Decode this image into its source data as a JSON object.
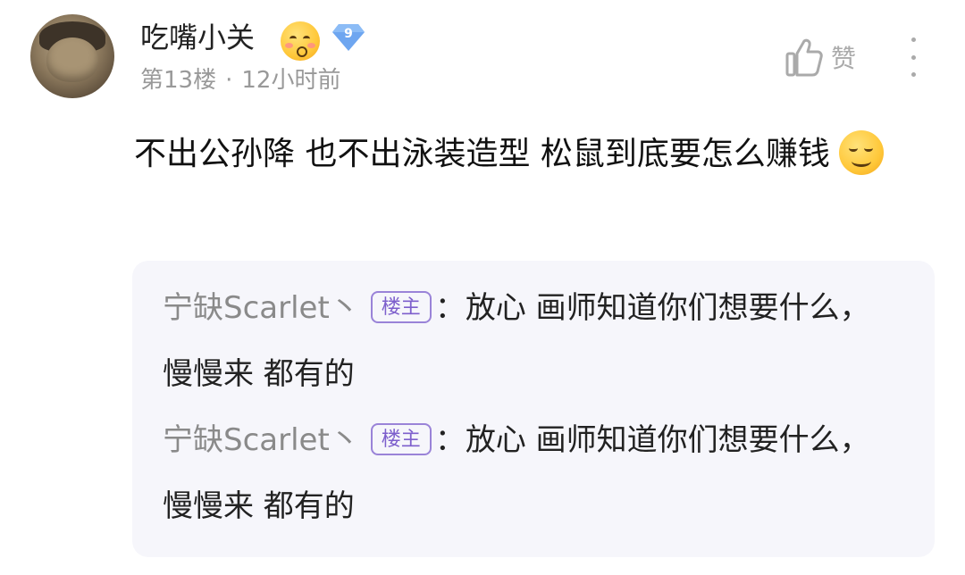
{
  "comment": {
    "user": {
      "name": "吃嘴小关",
      "level": "9",
      "avatar_icon": "avatar-image",
      "name_emoji": "kissing-blushing-face-emoji"
    },
    "floor": "第13楼",
    "separator": "·",
    "time": "12小时前",
    "like_label": "赞",
    "content": "不出公孙降 也不出泳装造型 松鼠到底要怎么赚钱",
    "content_emoji": "laughing-face-emoji"
  },
  "replies": [
    {
      "author": "宁缺Scarlet丶",
      "badge": "楼主",
      "separator": "：",
      "text": "放心 画师知道你们想要什么，慢慢来 都有的"
    },
    {
      "author": "宁缺Scarlet丶",
      "badge": "楼主",
      "separator": "：",
      "text": "放心 画师知道你们想要什么，慢慢来 都有的"
    }
  ],
  "colors": {
    "op_badge": "#7d5fcc",
    "level_badge": "#6ea6f0",
    "reply_background": "#f6f6fb"
  }
}
